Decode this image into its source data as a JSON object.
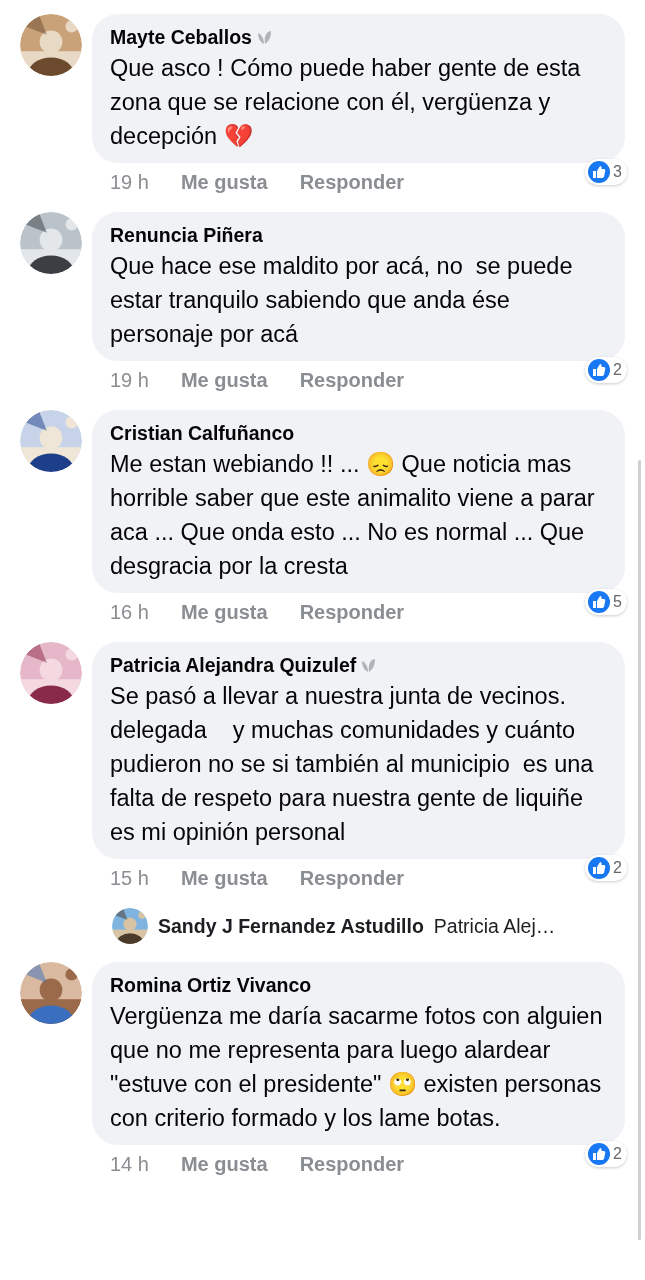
{
  "comments": [
    {
      "kind": "comment",
      "author": "Mayte Ceballos",
      "badge": true,
      "text": "Que asco ! Cómo puede haber gente de esta zona que se relacione con él, vergüenza y decepción 💔",
      "time": "19 h",
      "like": "Me gusta",
      "reply": "Responder",
      "reactions": "3"
    },
    {
      "kind": "comment",
      "author": "Renuncia Piñera",
      "badge": false,
      "text": "Que hace ese maldito por acá, no  se puede estar tranquilo sabiendo que anda ése personaje por acá",
      "time": "19 h",
      "like": "Me gusta",
      "reply": "Responder",
      "reactions": "2"
    },
    {
      "kind": "comment",
      "author": "Cristian Calfuñanco",
      "badge": false,
      "text": "Me estan webiando !! ... 😞 Que noticia mas horrible saber que este animalito viene a parar aca ... Que onda esto ... No es normal ... Que desgracia por la cresta",
      "time": "16 h",
      "like": "Me gusta",
      "reply": "Responder",
      "reactions": "5"
    },
    {
      "kind": "comment",
      "author": "Patricia Alejandra Quizulef",
      "badge": true,
      "text": "Se pasó a llevar a nuestra junta de vecinos.   delegada    y muchas comunidades y cuánto pudieron no se si también al municipio  es una falta de respeto para nuestra gente de liquiñe es mi opinión personal",
      "time": "15 h",
      "like": "Me gusta",
      "reply": "Responder",
      "reactions": "2"
    },
    {
      "kind": "reply",
      "author": "Sandy J Fernandez Astudillo",
      "text": "Patricia Alej…"
    },
    {
      "kind": "comment",
      "author": "Romina Ortiz Vivanco",
      "badge": false,
      "text": "Vergüenza me daría sacarme fotos con alguien que no me representa para luego alardear \"estuve con el presidente\" 🙄 existen personas con criterio formado y los lame botas.",
      "time": "14 h",
      "like": "Me gusta",
      "reply": "Responder",
      "reactions": "2"
    }
  ]
}
